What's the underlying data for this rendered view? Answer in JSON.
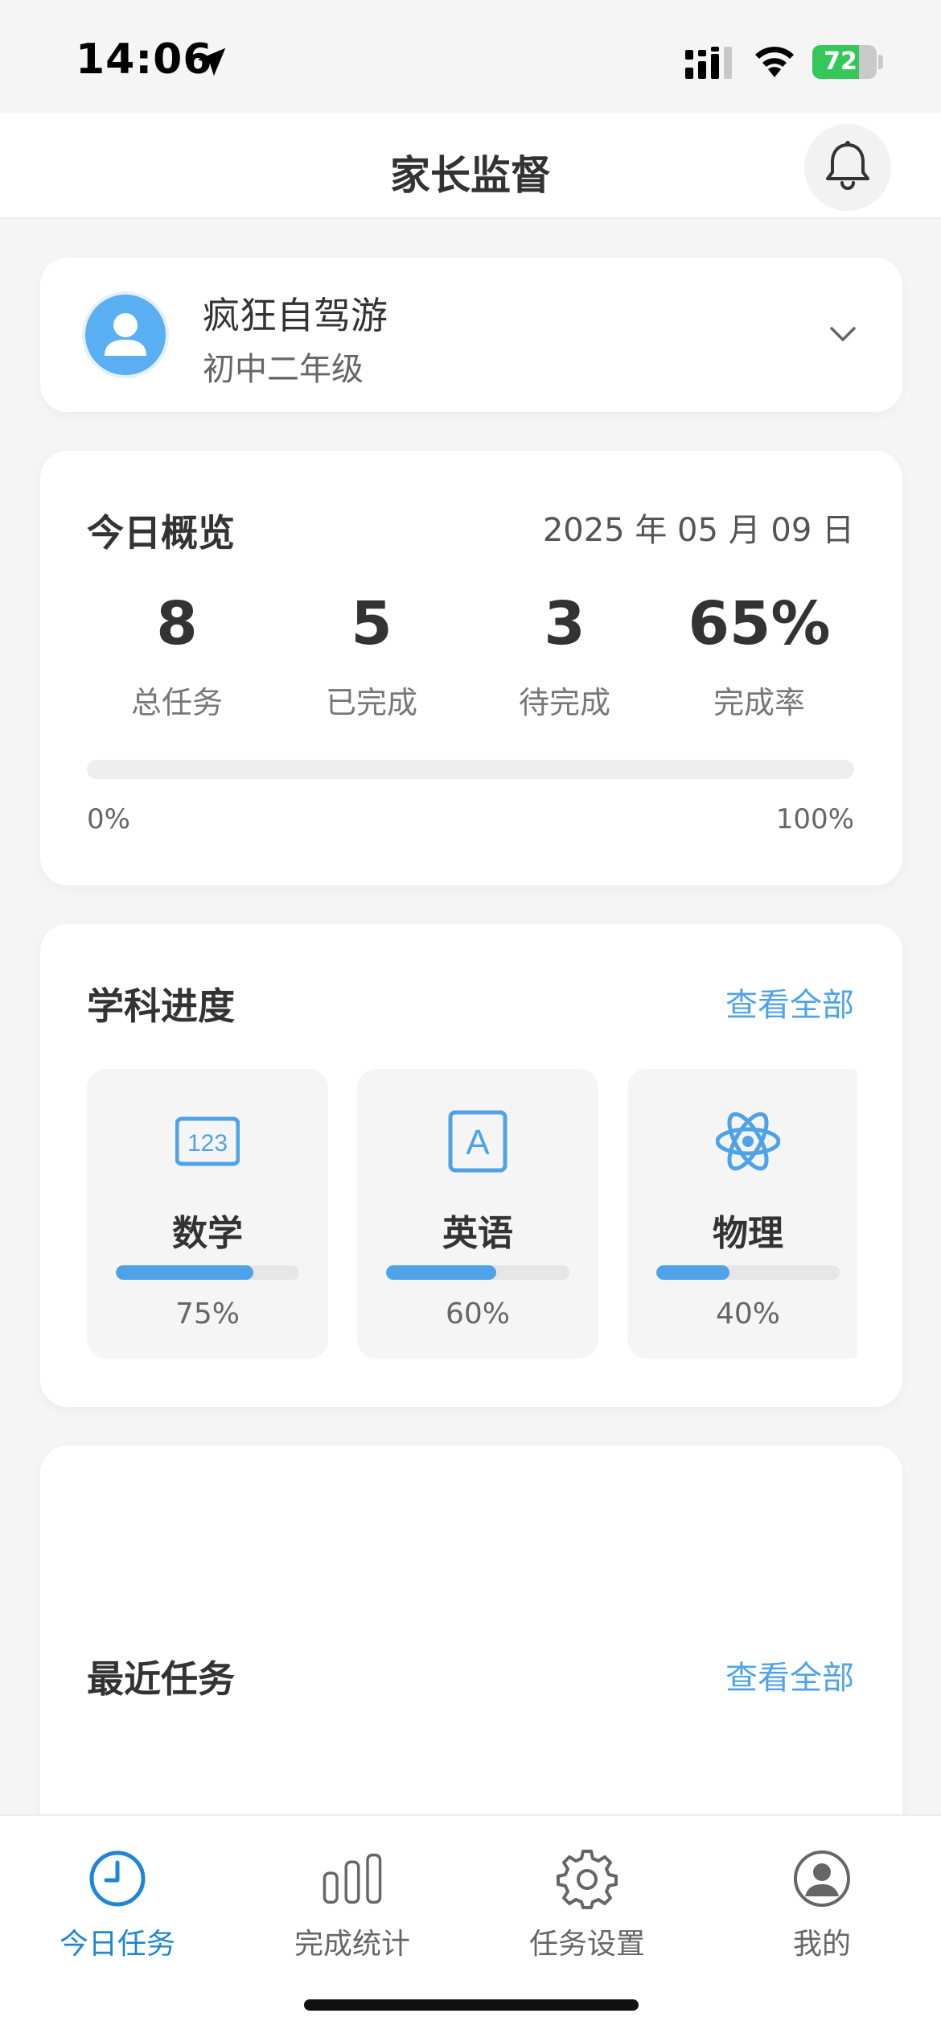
{
  "status_bar": {
    "time": "14:06",
    "battery": "72",
    "battery_level": 0.72,
    "icons": [
      "location-arrow-icon",
      "cellular-signal-icon",
      "wifi-icon",
      "battery-icon"
    ]
  },
  "header": {
    "title": "家长监督",
    "bell_icon": "bell-icon"
  },
  "profile": {
    "name": "疯狂自驾游",
    "grade": "初中二年级",
    "avatar_color": "#5aaef2"
  },
  "overview": {
    "title": "今日概览",
    "date": "2025 年 05 月 09 日",
    "stats": [
      {
        "value": "8",
        "label": "总任务"
      },
      {
        "value": "5",
        "label": "已完成"
      },
      {
        "value": "3",
        "label": "待完成"
      },
      {
        "value": "65%",
        "label": "完成率"
      }
    ],
    "progress_min": "0%",
    "progress_max": "100%"
  },
  "subjects": {
    "title": "学科进度",
    "view_all": "查看全部",
    "items": [
      {
        "name": "数学",
        "icon": "numbers-123-icon",
        "percent_label": "75%",
        "progress": 0.75
      },
      {
        "name": "英语",
        "icon": "letter-a-icon",
        "percent_label": "60%",
        "progress": 0.6
      },
      {
        "name": "物理",
        "icon": "atom-icon",
        "percent_label": "40%",
        "progress": 0.4
      }
    ]
  },
  "recent_tasks": {
    "title": "最近任务",
    "view_all": "查看全部"
  },
  "tabbar": {
    "items": [
      {
        "label": "今日任务",
        "icon": "clock-icon",
        "active": true
      },
      {
        "label": "完成统计",
        "icon": "bar-chart-icon",
        "active": false
      },
      {
        "label": "任务设置",
        "icon": "gear-icon",
        "active": false
      },
      {
        "label": "我的",
        "icon": "user-circle-icon",
        "active": false
      }
    ]
  },
  "colors": {
    "accent": "#4ea3e8",
    "active_tab": "#1f85d8",
    "background": "#f5f5f5",
    "battery": "#35c759"
  }
}
